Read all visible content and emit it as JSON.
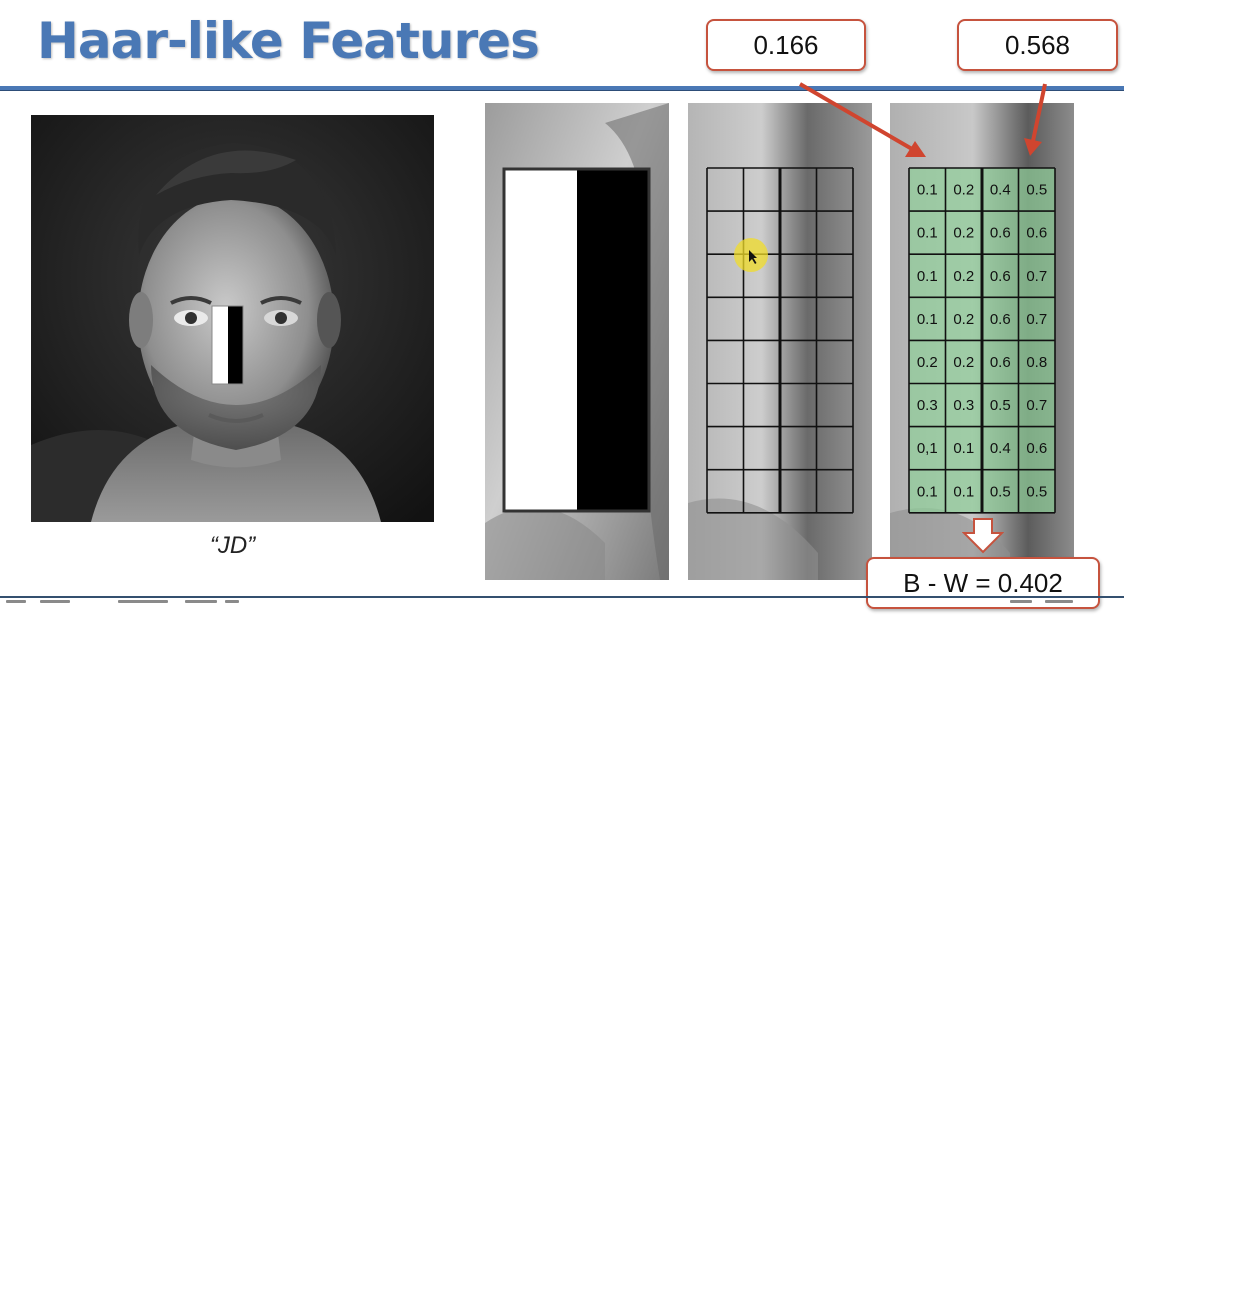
{
  "slide": {
    "title": "Haar-like Features",
    "caption": "“JD”",
    "callouts": {
      "white_mean": "0.166",
      "black_mean": "0.568",
      "difference": "B - W = 0.402"
    },
    "pixel_grid": {
      "rows": [
        [
          "0.1",
          "0.2",
          "0.4",
          "0.5"
        ],
        [
          "0.1",
          "0.2",
          "0.6",
          "0.6"
        ],
        [
          "0.1",
          "0.2",
          "0.6",
          "0.7"
        ],
        [
          "0.1",
          "0.2",
          "0.6",
          "0.7"
        ],
        [
          "0.2",
          "0.2",
          "0.6",
          "0.8"
        ],
        [
          "0.3",
          "0.3",
          "0.5",
          "0.7"
        ],
        [
          "0,1",
          "0.1",
          "0.4",
          "0.6"
        ],
        [
          "0.1",
          "0.1",
          "0.5",
          "0.5"
        ]
      ]
    },
    "colors": {
      "title": "#4a78b5",
      "rule": "#4a78b5",
      "callout_border": "#c6533e",
      "grid_fill": "#8fce98"
    },
    "icons": {
      "arrow": "red-arrow-icon",
      "down_arrow": "down-arrow-icon",
      "cursor": "cursor-highlight-icon"
    }
  }
}
